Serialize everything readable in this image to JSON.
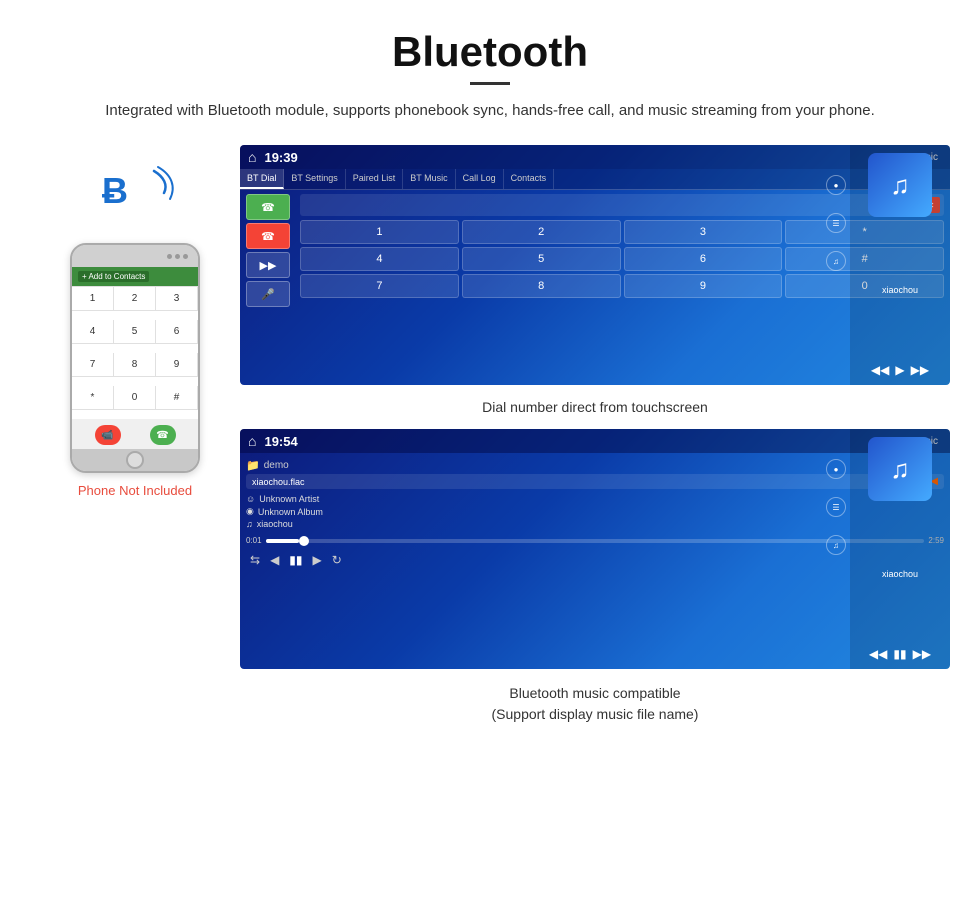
{
  "header": {
    "title": "Bluetooth",
    "subtitle": "Integrated with  Bluetooth module, supports phonebook sync, hands-free call, and music streaming from your phone."
  },
  "phone": {
    "not_included": "Phone Not Included",
    "screen_label": "+ Add to Contacts",
    "dial_keys": [
      "1",
      "2",
      "3",
      "4",
      "5",
      "6",
      "7",
      "8",
      "9",
      "*",
      "0",
      "#"
    ],
    "action_keys": [
      "✆",
      "✆"
    ]
  },
  "screen1": {
    "time": "19:39",
    "tabs": [
      "BT Dial",
      "BT Settings",
      "Paired List",
      "BT Music",
      "Call Log",
      "Contacts"
    ],
    "active_tab": "BT Dial",
    "numpad": [
      "1",
      "2",
      "3",
      "*",
      "4",
      "5",
      "6",
      "#",
      "7",
      "8",
      "9",
      "0"
    ],
    "music_title": "xiaochou",
    "music_label": "Music",
    "caption": "Dial number direct from touchscreen"
  },
  "screen2": {
    "time": "19:54",
    "folder": "demo",
    "filename": "xiaochou.flac",
    "artist": "Unknown Artist",
    "album": "Unknown Album",
    "song": "xiaochou",
    "time_start": "0:01",
    "time_end": "2:59",
    "music_title": "xiaochou",
    "music_label": "Music",
    "caption_line1": "Bluetooth music compatible",
    "caption_line2": "(Support display music file name)"
  },
  "colors": {
    "accent": "#1a6fce",
    "phone_not_included": "#e84c3d",
    "screen_bg_start": "#0d1a7a",
    "screen_bg_end": "#2288e0"
  }
}
